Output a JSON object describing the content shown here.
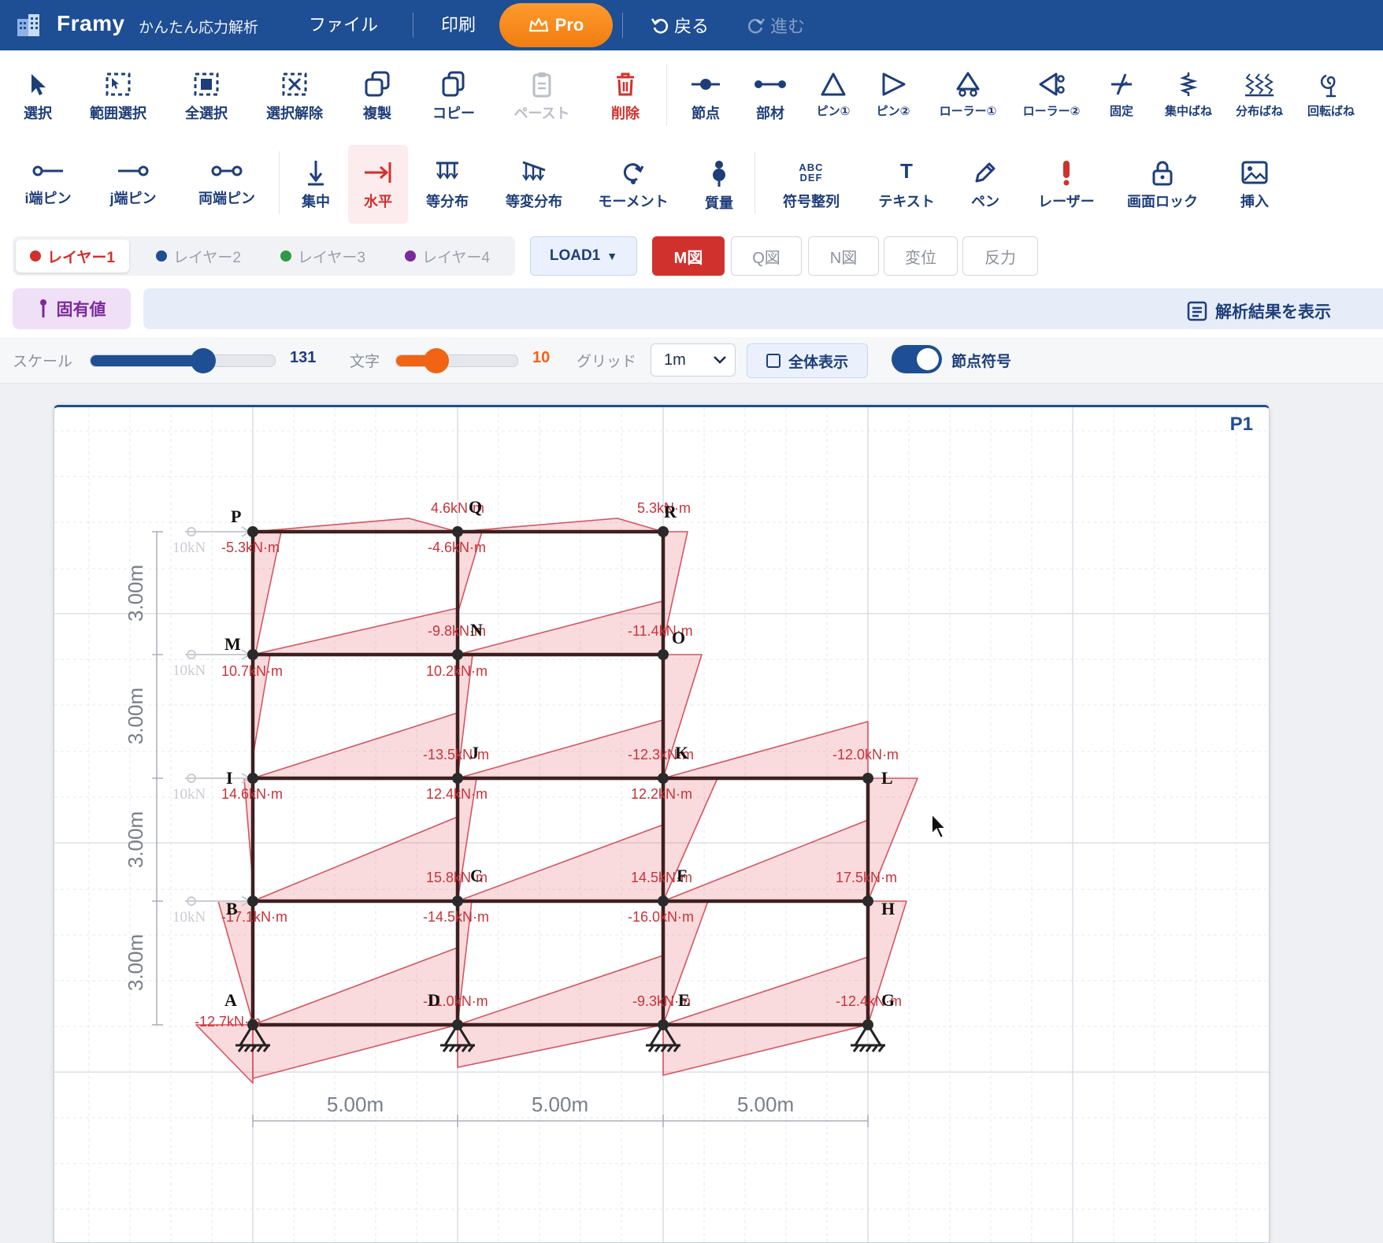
{
  "app": {
    "name": "Framy",
    "subtitle": "かんたん応力解析"
  },
  "topbar": {
    "file": "ファイル",
    "print": "印刷",
    "pro": "Pro",
    "undo": "戻る",
    "redo": "進む"
  },
  "toolbar1": [
    {
      "id": "select",
      "label": "選択",
      "icon": "cursor-icon"
    },
    {
      "id": "range-select",
      "label": "範囲選択",
      "icon": "range-select-icon"
    },
    {
      "id": "select-all",
      "label": "全選択",
      "icon": "select-all-icon"
    },
    {
      "id": "deselect",
      "label": "選択解除",
      "icon": "deselect-icon"
    },
    {
      "id": "duplicate",
      "label": "複製",
      "icon": "duplicate-icon"
    },
    {
      "id": "copy",
      "label": "コピー",
      "icon": "copy-icon"
    },
    {
      "id": "paste",
      "label": "ペースト",
      "icon": "paste-icon"
    },
    {
      "id": "delete",
      "label": "削除",
      "icon": "trash-icon"
    },
    {
      "id": "node",
      "label": "節点",
      "icon": "node-icon"
    },
    {
      "id": "member",
      "label": "部材",
      "icon": "member-icon"
    },
    {
      "id": "pin1",
      "label": "ピン①",
      "icon": "pin-support-icon"
    },
    {
      "id": "pin2",
      "label": "ピン②",
      "icon": "pin-support-side-icon"
    },
    {
      "id": "roller1",
      "label": "ローラー①",
      "icon": "roller-support-icon"
    },
    {
      "id": "roller2",
      "label": "ローラー②",
      "icon": "roller-support-side-icon"
    },
    {
      "id": "fixed",
      "label": "固定",
      "icon": "fixed-support-icon"
    },
    {
      "id": "point-spring",
      "label": "集中ばね",
      "icon": "spring-icon"
    },
    {
      "id": "dist-spring",
      "label": "分布ばね",
      "icon": "distributed-spring-icon"
    },
    {
      "id": "rot-spring",
      "label": "回転ばね",
      "icon": "rotational-spring-icon"
    }
  ],
  "toolbar2": [
    {
      "id": "i-pin",
      "label": "i端ピン",
      "icon": "i-end-pin-icon"
    },
    {
      "id": "j-pin",
      "label": "j端ピン",
      "icon": "j-end-pin-icon"
    },
    {
      "id": "both-pin",
      "label": "両端ピン",
      "icon": "both-end-pin-icon"
    },
    {
      "id": "point-load",
      "label": "集中",
      "icon": "point-load-icon"
    },
    {
      "id": "horizontal-load",
      "label": "水平",
      "icon": "horizontal-load-icon"
    },
    {
      "id": "uniform-load",
      "label": "等分布",
      "icon": "uniform-load-icon"
    },
    {
      "id": "varying-load",
      "label": "等変分布",
      "icon": "varying-load-icon"
    },
    {
      "id": "moment",
      "label": "モーメント",
      "icon": "moment-icon"
    },
    {
      "id": "mass",
      "label": "質量",
      "icon": "mass-icon"
    },
    {
      "id": "auto-label",
      "label": "符号整列",
      "icon": "abc-def-icon",
      "icon_text": "ABC DEF"
    },
    {
      "id": "text",
      "label": "テキスト",
      "icon": "text-icon",
      "icon_text": "T"
    },
    {
      "id": "pen",
      "label": "ペン",
      "icon": "pen-icon"
    },
    {
      "id": "laser",
      "label": "レーザー",
      "icon": "laser-icon"
    },
    {
      "id": "screen-lock",
      "label": "画面ロック",
      "icon": "lock-icon"
    },
    {
      "id": "insert",
      "label": "挿入",
      "icon": "image-icon"
    }
  ],
  "layers": [
    {
      "label": "レイヤー1",
      "color": "#d0312d"
    },
    {
      "label": "レイヤー2",
      "color": "#1e4e93"
    },
    {
      "label": "レイヤー3",
      "color": "#2e9a47"
    },
    {
      "label": "レイヤー4",
      "color": "#7b2a9b"
    }
  ],
  "load_case": "LOAD1",
  "diagram_tabs": [
    "M図",
    "Q図",
    "N図",
    "変位",
    "反力"
  ],
  "eigen_label": "固有値",
  "results_label": "解析結果を表示",
  "settings": {
    "scale_label": "スケール",
    "scale_value": "131",
    "scale_fraction": 0.61,
    "text_label": "文字",
    "text_value": "10",
    "text_fraction": 0.33,
    "grid_label": "グリッド",
    "grid_value": "1m",
    "fit_label": "全体表示",
    "node_label_toggle": "節点符号"
  },
  "canvas": {
    "page": "P1",
    "span_labels": [
      "5.00m",
      "5.00m",
      "5.00m"
    ],
    "story_labels": [
      "3.00m",
      "3.00m",
      "3.00m",
      "3.00m"
    ],
    "load_label": "10kN",
    "nodes": [
      "A",
      "B",
      "C",
      "D",
      "E",
      "F",
      "G",
      "H",
      "I",
      "J",
      "K",
      "L",
      "M",
      "N",
      "O",
      "P",
      "Q",
      "R"
    ],
    "moment_labels": [
      "-5.3kN·m",
      "4.6kN·m",
      "-4.6kN·m",
      "5.3kN·m",
      "-9.8kN·m",
      "10.7kN·m",
      "10.2kN·m",
      "-11.4kN·m",
      "-13.5kN·m",
      "14.6kN·m",
      "12.4kN·m",
      "-12.3kN·m",
      "12.2kN·m",
      "-12.0kN·m",
      "15.8kN·m",
      "-17.1kN·m",
      "-14.5kN·m",
      "14.5kN·m",
      "-16.0kN·m",
      "17.5kN·m",
      "-12.7kN·m",
      "-11.0kN·m",
      "-9.3kN·m",
      "-12.4kN·m"
    ]
  }
}
